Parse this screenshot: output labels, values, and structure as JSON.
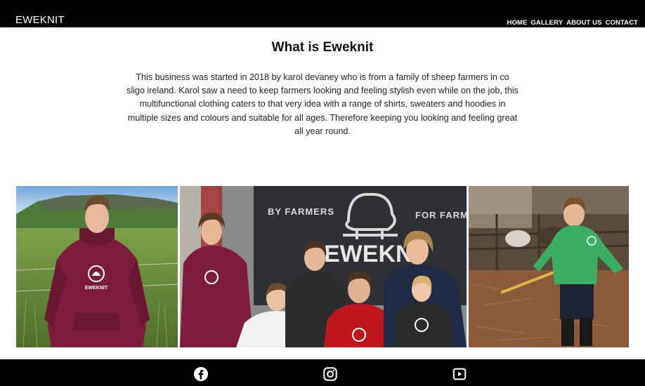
{
  "header": {
    "brand": "EWEKNIT",
    "nav": [
      "HOME",
      "GALLERY",
      "ABOUT US",
      "CONTACT"
    ]
  },
  "main": {
    "title": "What is Eweknit",
    "intro": "This business was started in 2018 by karol devaney who is from a family of sheep farmers in co sligo ireland. Karol saw a need to keep farmers looking and feeling stylish even while on the job, this multifunctional clothing caters to that very idea with a range of shirts, sweaters and hoodies in multiple sizes and colours and suitable for all ages. Therefore keeping you looking and feeling great all year round."
  },
  "gallery": {
    "photo2_banner_left": "BY FARMERS",
    "photo2_banner_right": "FOR FARME",
    "photo2_banner_brand": "EWEKNI",
    "hoodie_logo": "EWEKNIT"
  },
  "footer": {
    "icons": [
      "facebook-icon",
      "instagram-icon",
      "youtube-icon"
    ]
  },
  "colors": {
    "header_bg": "#000000",
    "maroon": "#7d1d3b",
    "red": "#c2161e",
    "green": "#3cae64"
  }
}
